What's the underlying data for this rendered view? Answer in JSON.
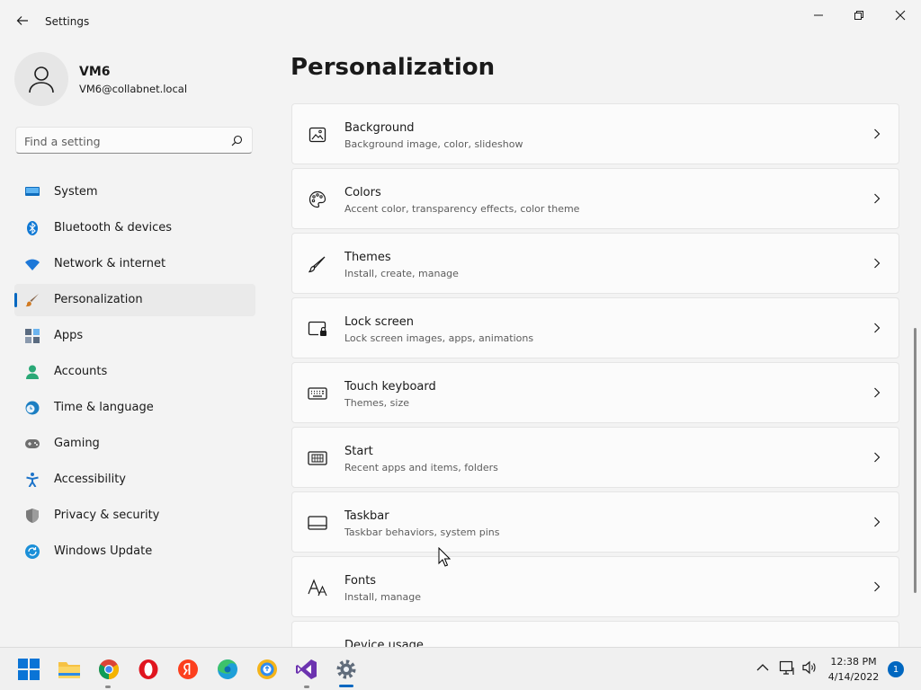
{
  "app": {
    "title": "Settings"
  },
  "profile": {
    "name": "VM6",
    "email": "VM6@collabnet.local"
  },
  "search": {
    "placeholder": "Find a setting"
  },
  "nav": {
    "items": [
      {
        "label": "System",
        "icon": "system-icon",
        "color": "#0f6cbd"
      },
      {
        "label": "Bluetooth & devices",
        "icon": "bluetooth-icon",
        "color": "#0f78d4"
      },
      {
        "label": "Network & internet",
        "icon": "wifi-icon",
        "color": "#1d78d8"
      },
      {
        "label": "Personalization",
        "icon": "brush-icon",
        "color": "#d17a22",
        "active": true
      },
      {
        "label": "Apps",
        "icon": "apps-icon",
        "color": "#5a6b80"
      },
      {
        "label": "Accounts",
        "icon": "person-icon",
        "color": "#2aa876"
      },
      {
        "label": "Time & language",
        "icon": "globe-clock-icon",
        "color": "#1b7ec2"
      },
      {
        "label": "Gaming",
        "icon": "gamepad-icon",
        "color": "#6e6e6e"
      },
      {
        "label": "Accessibility",
        "icon": "accessibility-icon",
        "color": "#1c73c9"
      },
      {
        "label": "Privacy & security",
        "icon": "shield-icon",
        "color": "#7a7a7a"
      },
      {
        "label": "Windows Update",
        "icon": "update-icon",
        "color": "#1b8fd8"
      }
    ]
  },
  "main": {
    "title": "Personalization",
    "cards": [
      {
        "title": "Background",
        "subtitle": "Background image, color, slideshow",
        "icon": "image-icon"
      },
      {
        "title": "Colors",
        "subtitle": "Accent color, transparency effects, color theme",
        "icon": "palette-icon"
      },
      {
        "title": "Themes",
        "subtitle": "Install, create, manage",
        "icon": "pen-icon"
      },
      {
        "title": "Lock screen",
        "subtitle": "Lock screen images, apps, animations",
        "icon": "lock-screen-icon"
      },
      {
        "title": "Touch keyboard",
        "subtitle": "Themes, size",
        "icon": "keyboard-icon"
      },
      {
        "title": "Start",
        "subtitle": "Recent apps and items, folders",
        "icon": "start-icon"
      },
      {
        "title": "Taskbar",
        "subtitle": "Taskbar behaviors, system pins",
        "icon": "taskbar-icon"
      },
      {
        "title": "Fonts",
        "subtitle": "Install, manage",
        "icon": "fonts-icon"
      },
      {
        "title": "Device usage",
        "subtitle": "",
        "icon": "device-usage-icon"
      }
    ]
  },
  "taskbar": {
    "apps": [
      "windows-start-icon",
      "file-explorer-icon",
      "chrome-icon",
      "opera-icon",
      "yandex-icon",
      "edge-icon",
      "browser-icon",
      "visual-studio-icon",
      "settings-icon"
    ],
    "time": "12:38 PM",
    "date": "4/14/2022",
    "notifications": "1"
  },
  "colors": {
    "accent": "#0067c0",
    "background": "#f3f3f3",
    "card": "#fbfbfb"
  }
}
